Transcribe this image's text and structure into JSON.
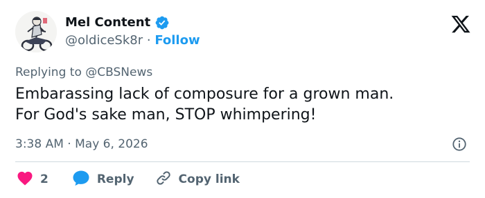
{
  "tweet": {
    "author": {
      "display_name": "Mel Content",
      "handle": "@oldiceSk8r",
      "separator": "·",
      "follow_label": "Follow"
    },
    "replying_to": {
      "prefix": "Replying to",
      "handle": "@CBSNews"
    },
    "text_lines": [
      "Embarassing lack of composure for a grown man.",
      "For God's sake man, STOP whimpering!"
    ],
    "meta": {
      "time": "3:38 AM",
      "separator": "·",
      "date": "May 6, 2026"
    },
    "actions": {
      "like_count": "2",
      "reply_label": "Reply",
      "copy_link_label": "Copy link"
    }
  },
  "colors": {
    "text": "#0f1419",
    "secondary": "#536471",
    "accent": "#1d9bf0",
    "like": "#f91880",
    "divider": "#cfd9de"
  },
  "icons": {
    "verified": "verified-badge-icon",
    "logo": "x-logo-icon",
    "info": "info-icon",
    "like": "heart-icon",
    "reply": "speech-bubble-icon",
    "copy_link": "link-icon"
  }
}
